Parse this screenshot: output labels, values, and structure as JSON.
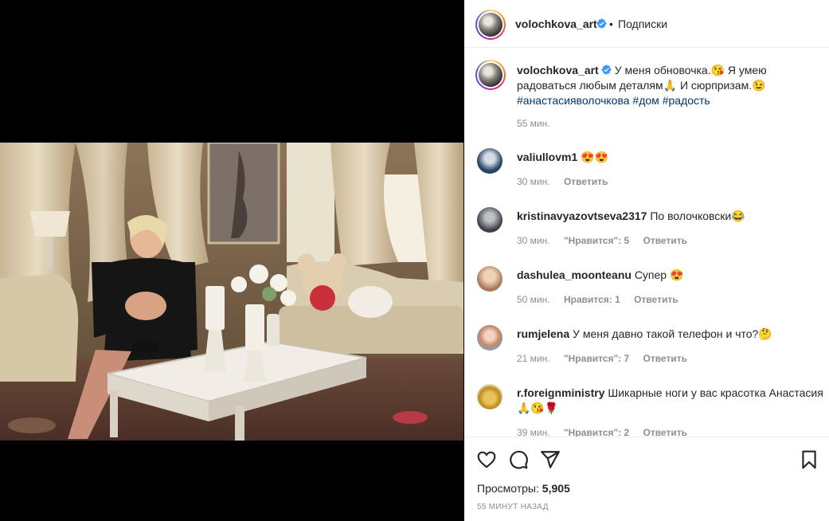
{
  "post": {
    "username": "volochkova_art",
    "follow_label": "Подписки",
    "dot": "•",
    "caption_text": "У меня обновочка.😘 Я умею радоваться любым деталям🙏 И сюрпризам.😉 ",
    "hashtags": [
      "#анастасияволочкова",
      "#дом",
      "#радость"
    ],
    "caption_time": "55 мин."
  },
  "comments": [
    {
      "username": "valiullovm1",
      "text": "😍😍",
      "time": "30 мин.",
      "likes": "",
      "reply": "Ответить"
    },
    {
      "username": "kristinavyazovtseva2317",
      "text": "По волочковски😂",
      "time": "30 мин.",
      "likes": "\"Нравится\": 5",
      "reply": "Ответить"
    },
    {
      "username": "dashulea_moonteanu",
      "text": "Супер 😍",
      "time": "50 мин.",
      "likes": "Нравится: 1",
      "reply": "Ответить"
    },
    {
      "username": "rumjelena",
      "text": "У меня давно такой телефон и что?🤔",
      "time": "21 мин.",
      "likes": "\"Нравится\": 7",
      "reply": "Ответить"
    },
    {
      "username": "r.foreignministry",
      "text": "Шикарные ноги у вас красотка Анастасия 🙏😘🌹",
      "time": "39 мин.",
      "likes": "\"Нравится\": 2",
      "reply": "Ответить"
    }
  ],
  "actions": {
    "views_label": "Просмотры:",
    "views_count": "5,905",
    "posted_ago": "55 МИНУТ НАЗАД"
  },
  "icons": [
    "heart-icon",
    "comment-icon",
    "share-icon",
    "bookmark-icon",
    "verified-badge-icon"
  ],
  "colors": {
    "verified": "#3897f0",
    "hashtag": "#00376b",
    "muted": "#8e8e8e",
    "text": "#262626"
  }
}
